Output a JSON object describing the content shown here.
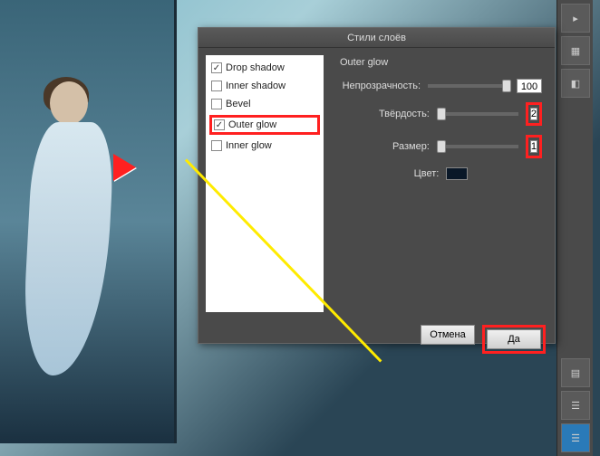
{
  "dialog": {
    "title": "Стили слоёв",
    "styles": [
      {
        "label": "Drop shadow",
        "checked": true
      },
      {
        "label": "Inner shadow",
        "checked": false
      },
      {
        "label": "Bevel",
        "checked": false
      },
      {
        "label": "Outer glow",
        "checked": true,
        "highlighted": true
      },
      {
        "label": "Inner glow",
        "checked": false
      }
    ],
    "section_title": "Outer glow",
    "opacity": {
      "label": "Непрозрачность:",
      "value": "100"
    },
    "hardness": {
      "label": "Твёрдость:",
      "value": "2"
    },
    "size": {
      "label": "Размер:",
      "value": "1"
    },
    "color": {
      "label": "Цвет:",
      "hex": "#0a1828"
    },
    "cancel": "Отмена",
    "ok": "Да"
  }
}
